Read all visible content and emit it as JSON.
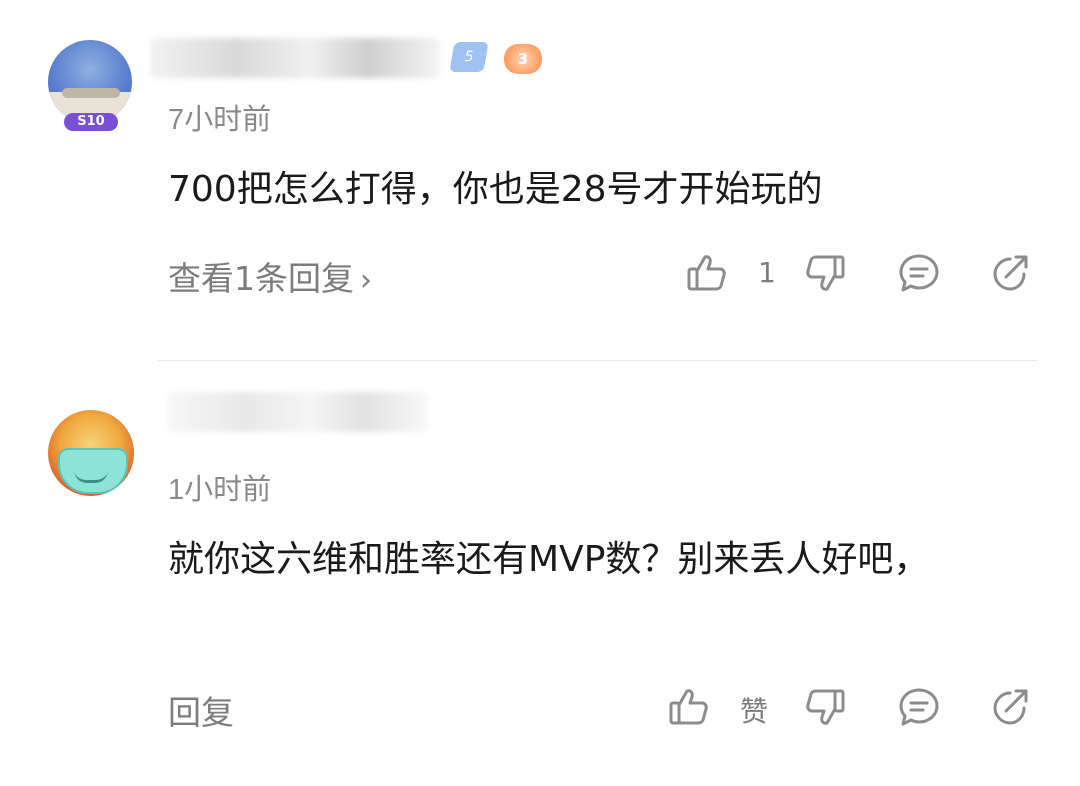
{
  "comments": [
    {
      "time": "7小时前",
      "text": "700把怎么打得，你也是28号才开始玩的",
      "action_label": "查看1条回复",
      "chevron": "›",
      "like_count": "1",
      "level_badge": "5",
      "medal_badge": "3",
      "avatar_badge": "S10"
    },
    {
      "time": "1小时前",
      "text": "就你这六维和胜率还有MVP数？别来丢人好吧，",
      "action_label": "回复",
      "like_count": "赞"
    }
  ],
  "icons": {
    "like": "thumbs-up-icon",
    "dislike": "thumbs-down-icon",
    "comment": "comment-icon",
    "share": "share-icon"
  },
  "colors": {
    "primary_text": "#1a1a1a",
    "secondary_text": "#8a8a8a",
    "icon_stroke": "#8c8c8c",
    "divider": "#ececec"
  }
}
